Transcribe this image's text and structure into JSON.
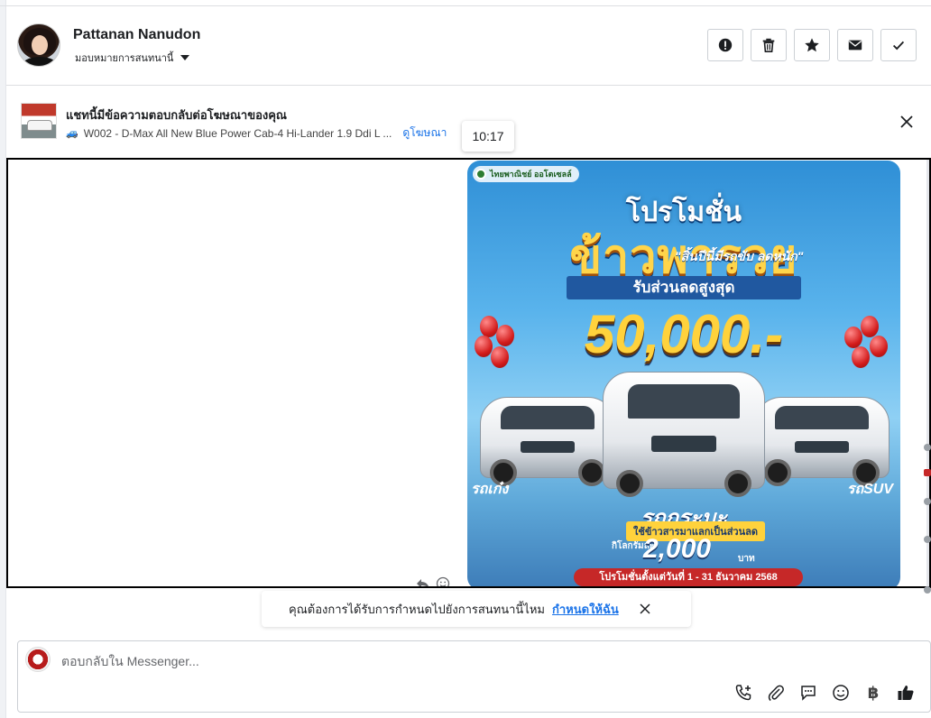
{
  "header": {
    "user_name": "Pattanan Nanudon",
    "assign_label": "มอบหมายการสนทนานี้",
    "buttons": [
      {
        "name": "spam",
        "icon": "exclamation-circle-icon"
      },
      {
        "name": "delete",
        "icon": "trash-icon"
      },
      {
        "name": "star",
        "icon": "star-icon"
      },
      {
        "name": "mark-unread",
        "icon": "envelope-icon"
      },
      {
        "name": "done",
        "icon": "check-icon"
      }
    ]
  },
  "ad_banner": {
    "title": "แชทนี้มีข้อความตอบกลับต่อโฆษณาของคุณ",
    "subtitle": "W002 - D-Max All New Blue Power Cab-4 Hi-Lander 1.9 Ddi L ...",
    "link": "ดูโฆษณา",
    "tooltip_time": "10:17"
  },
  "message_image": {
    "logo_text": "ไทยพาณิชย์ ออโตเซลล์",
    "headline": "โปรโมชั่น",
    "headline_big": "ข้าวพารวย",
    "tagline": "\"สิ้นปีนี้มีรถขับ ลดหนัก\"",
    "discount_label": "รับส่วนลดสูงสุด",
    "discount_value": "50,000.-",
    "sedan_label": "รถเก๋ง",
    "suv_label": "รถSUV",
    "pickup_label": "รถกระบะ",
    "rice_note": "ใช้ข้าวสารมาแลกเป็นส่วนลด",
    "mileage_label": "กิโลกรัมละ",
    "mileage_value": "2,000",
    "mileage_unit": "บาท",
    "period": "โปรโมชั่นตั้งแต่วันที่ 1 - 31 ธันวาคม 2568"
  },
  "assign_prompt": {
    "text": "คุณต้องการได้รับการกำหนดไปยังการสนทนานี้ไหม",
    "link": "กำหนดให้ฉัน"
  },
  "composer": {
    "placeholder": "ตอบกลับใน Messenger..."
  },
  "colors": {
    "accent": "#1a73e8",
    "border": "#ccd0d5",
    "text": "#1c1e21"
  }
}
